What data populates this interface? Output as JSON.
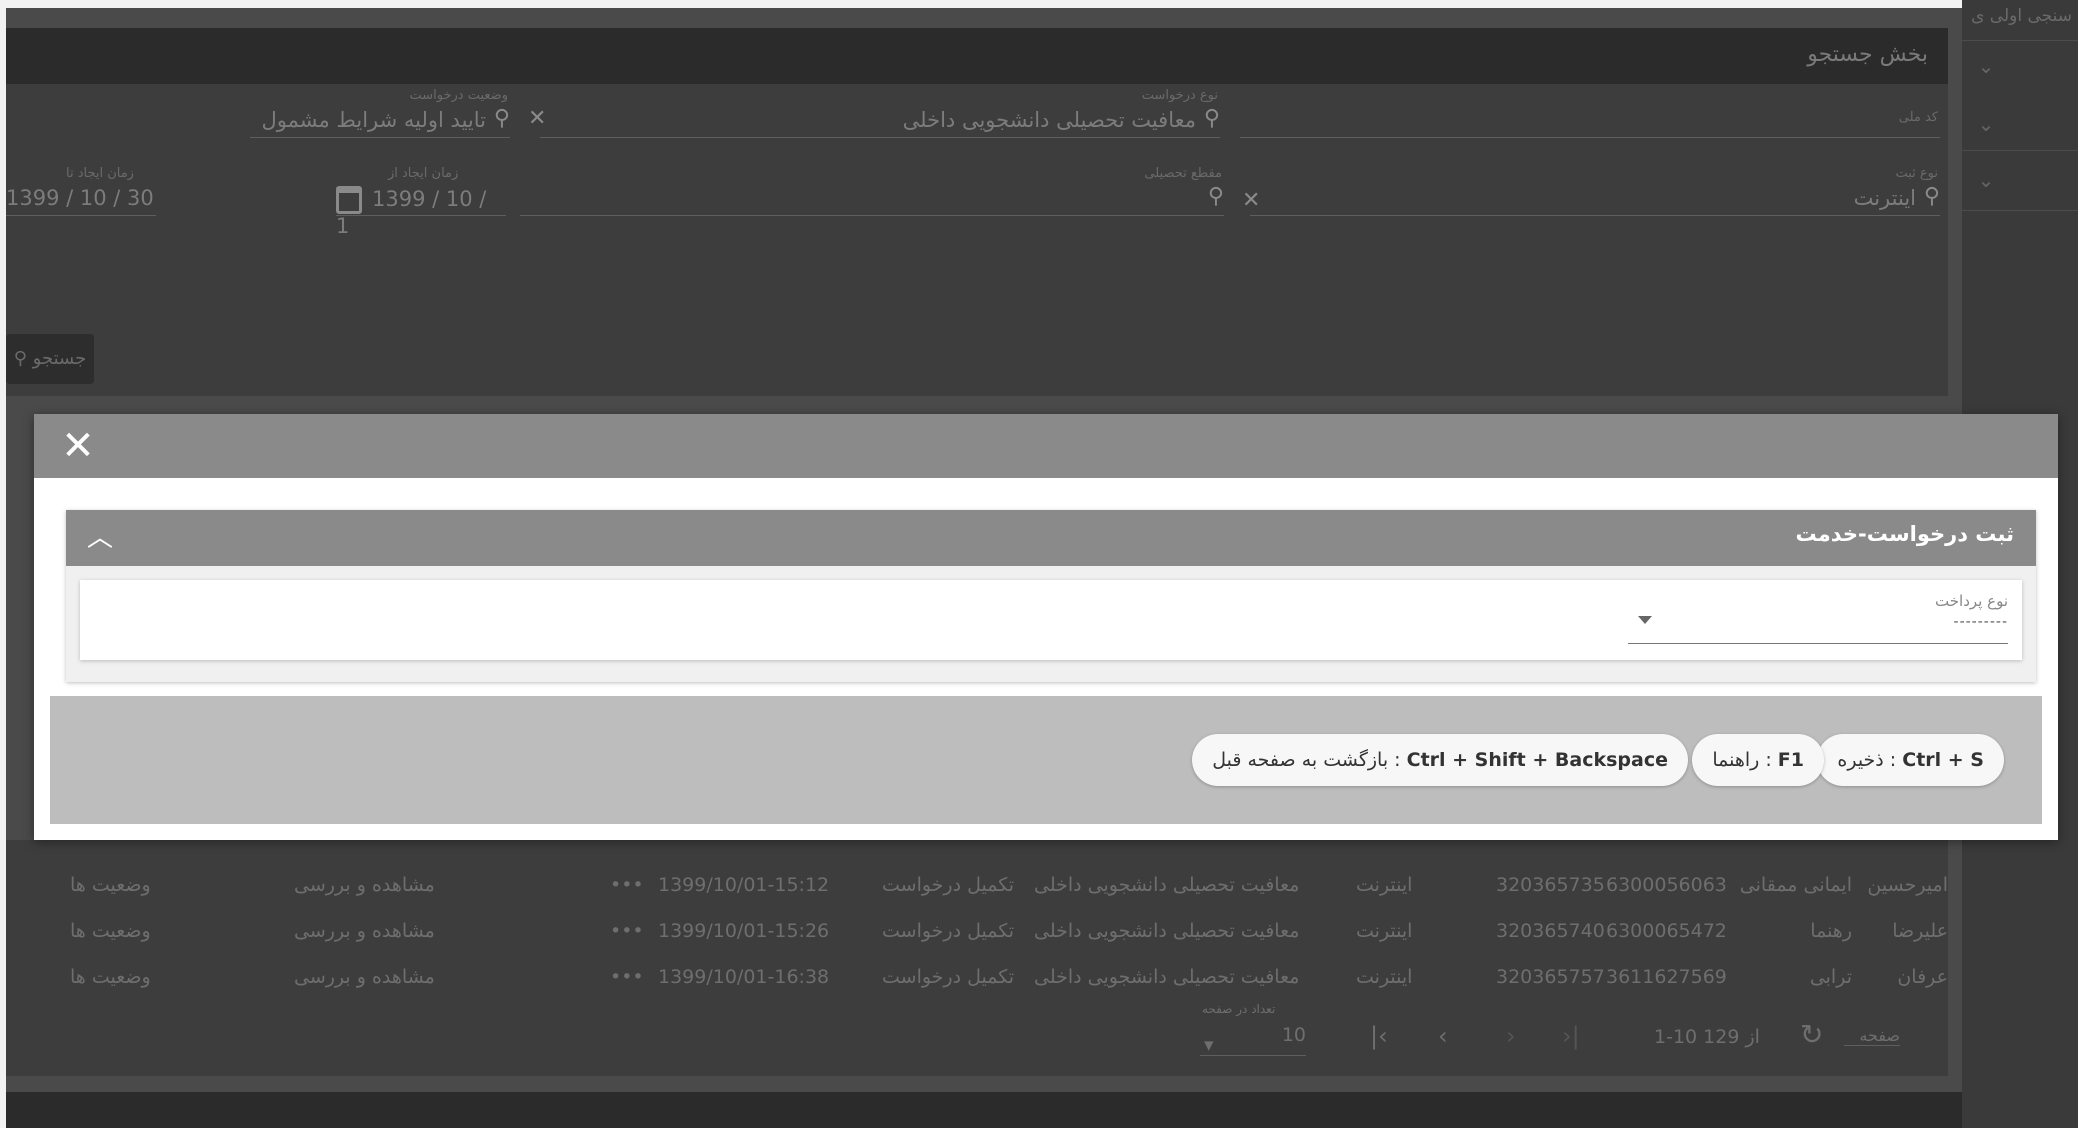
{
  "background": {
    "rail_label": "سنجی اولی ی",
    "search_title": "بخش جستجو",
    "fields": {
      "national_code_label": "کد ملی",
      "request_type_label": "نوع درخواست",
      "request_type_value": "معافیت تحصیلی دانشجویی داخلی",
      "request_status_label": "وضعیت درخواست",
      "request_status_value": "تایید اولیه شرایط مشمول",
      "register_type_label": "نوع ثبت",
      "register_type_value": "اینترنت",
      "education_level_label": "مقطع تحصیلی",
      "date_from_label": "زمان ایجاد از",
      "date_from_value": "1399 / 10 / 1",
      "date_to_label": "زمان ایجاد تا",
      "date_to_value": "1399 / 10 / 30"
    },
    "search_button": "جستجو",
    "rows": [
      {
        "first": "امیرحسین",
        "last": "ایمانی ممقانی",
        "national": "6300056063",
        "tracking": "320365735",
        "channel": "اینترنت",
        "type": "معافیت تحصیلی دانشجویی داخلی",
        "status": "تکمیل درخواست",
        "date": "1399/10/01-15:12",
        "more": "•••",
        "view": "مشاهده و بررسی",
        "states": "وضعیت ها"
      },
      {
        "first": "علیرضا",
        "last": "رهنما",
        "national": "6300065472",
        "tracking": "320365740",
        "channel": "اینترنت",
        "type": "معافیت تحصیلی دانشجویی داخلی",
        "status": "تکمیل درخواست",
        "date": "1399/10/01-15:26",
        "more": "•••",
        "view": "مشاهده و بررسی",
        "states": "وضعیت ها"
      },
      {
        "first": "عرفان",
        "last": "ترابی",
        "national": "3611627569",
        "tracking": "320365757",
        "channel": "اینترنت",
        "type": "معافیت تحصیلی دانشجویی داخلی",
        "status": "تکمیل درخواست",
        "date": "1399/10/01-16:38",
        "more": "•••",
        "view": "مشاهده و بررسی",
        "states": "وضعیت ها"
      }
    ],
    "pager": {
      "per_page_label": "تعداد در صفحه",
      "per_page_value": "10",
      "range": "1-10 از 129",
      "page_label": "صفحه"
    }
  },
  "modal": {
    "card_title": "ثبت درخواست-خدمت",
    "payment_type_label": "نوع پرداخت",
    "payment_type_value": "---------",
    "shortcuts": [
      {
        "keys": "Ctrl + S",
        "text": " : ذخیره"
      },
      {
        "keys": "F1",
        "text": " : راهنما"
      },
      {
        "keys": "Ctrl + Shift + Backspace",
        "text": " : بازگشت به صفحه قبل"
      }
    ]
  }
}
